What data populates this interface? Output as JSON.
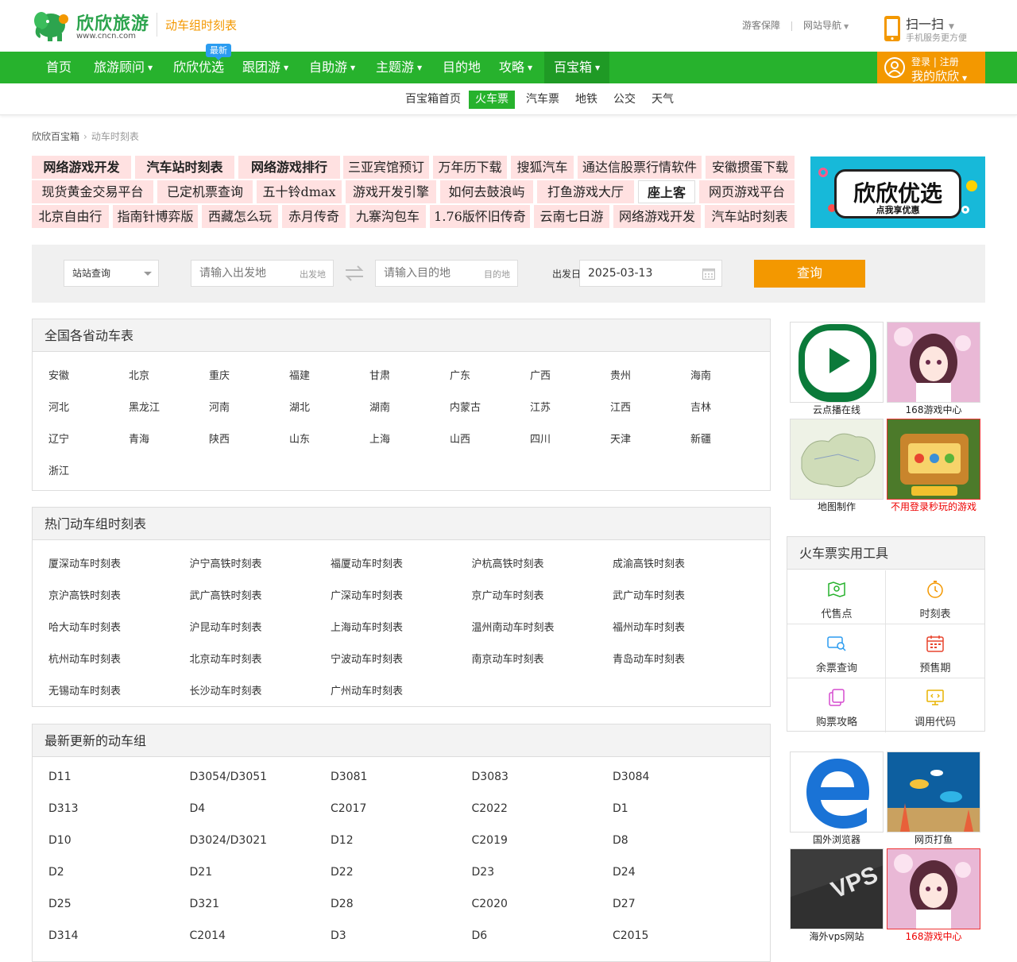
{
  "header": {
    "logo_name": "欣欣旅游",
    "logo_url": "www.cncn.com",
    "page_subtitle": "动车组时刻表",
    "top_links": [
      "游客保障",
      "网站导航"
    ],
    "scan_title": "扫一扫",
    "scan_sub": "手机服务更方便"
  },
  "nav": {
    "items": [
      "首页",
      "旅游顾问",
      "欣欣优选",
      "跟团游",
      "自助游",
      "主题游",
      "目的地",
      "攻略",
      "百宝箱"
    ],
    "new_badge": "最新",
    "login": "登录",
    "register": "注册",
    "my": "我的欣欣"
  },
  "subnav": {
    "items": [
      "百宝箱首页",
      "火车票",
      "汽车票",
      "地铁",
      "公交",
      "天气"
    ],
    "active": "火车票"
  },
  "breadcrumb": {
    "home": "欣欣百宝箱",
    "current": "动车时刻表"
  },
  "ad_tags": [
    "网络游戏开发",
    "汽车站时刻表",
    "网络游戏排行",
    "三亚宾馆预订",
    "万年历下载",
    "搜狐汽车",
    "通达信股票行情软件",
    "安徽掼蛋下载",
    "现货黄金交易平台",
    "已定机票查询",
    "五十铃dmax",
    "游戏开发引擎",
    "如何去鼓浪屿",
    "打鱼游戏大厅",
    "座上客",
    "网页游戏平台",
    "北京自由行",
    "指南针博弈版",
    "西藏怎么玩",
    "赤月传奇",
    "九寨沟包车",
    "1.76版怀旧传奇",
    "云南七日游",
    "网络游戏开发",
    "汽车站时刻表"
  ],
  "banner": {
    "title": "欣欣优选",
    "sub": "点我享优惠"
  },
  "search": {
    "mode": "站站查询",
    "from_placeholder": "请输入出发地",
    "from_hint": "出发地",
    "to_placeholder": "请输入目的地",
    "to_hint": "目的地",
    "date_label": "出发日期",
    "date": "2025-03-13",
    "button": "查询"
  },
  "provinces": {
    "title": "全国各省动车表",
    "items": [
      "安徽",
      "北京",
      "重庆",
      "福建",
      "甘肃",
      "广东",
      "广西",
      "贵州",
      "海南",
      "河北",
      "黑龙江",
      "河南",
      "湖北",
      "湖南",
      "内蒙古",
      "江苏",
      "江西",
      "吉林",
      "辽宁",
      "青海",
      "陕西",
      "山东",
      "上海",
      "山西",
      "四川",
      "天津",
      "新疆",
      "浙江"
    ]
  },
  "hot": {
    "title": "热门动车组时刻表",
    "items": [
      "厦深动车时刻表",
      "沪宁高铁时刻表",
      "福厦动车时刻表",
      "沪杭高铁时刻表",
      "成渝高铁时刻表",
      "京沪高铁时刻表",
      "武广高铁时刻表",
      "广深动车时刻表",
      "京广动车时刻表",
      "武广动车时刻表",
      "哈大动车时刻表",
      "沪昆动车时刻表",
      "上海动车时刻表",
      "温州南动车时刻表",
      "福州动车时刻表",
      "杭州动车时刻表",
      "北京动车时刻表",
      "宁波动车时刻表",
      "南京动车时刻表",
      "青岛动车时刻表",
      "无锡动车时刻表",
      "长沙动车时刻表",
      "广州动车时刻表"
    ]
  },
  "latest": {
    "title": "最新更新的动车组",
    "items": [
      "D11",
      "D3054/D3051",
      "D3081",
      "D3083",
      "D3084",
      "D313",
      "D4",
      "C2017",
      "C2022",
      "D1",
      "D10",
      "D3024/D3021",
      "D12",
      "C2019",
      "D8",
      "D2",
      "D21",
      "D22",
      "D23",
      "D24",
      "D25",
      "D321",
      "D28",
      "C2020",
      "D27",
      "D314",
      "C2014",
      "D3",
      "D6",
      "C2015"
    ]
  },
  "side_ads_top": [
    "云点播在线",
    "168游戏中心",
    "地图制作",
    "不用登录秒玩的游戏"
  ],
  "tools": {
    "title": "火车票实用工具",
    "items": [
      "代售点",
      "时刻表",
      "余票查询",
      "预售期",
      "购票攻略",
      "调用代码"
    ]
  },
  "side_ads_bottom": [
    "国外浏览器",
    "网页打鱼",
    "海外vps网站",
    "168游戏中心"
  ],
  "colors": {
    "brand_green": "#27b22d",
    "accent_orange": "#f39800",
    "tag_pink": "#ffe1e1",
    "ad_red": "#ee0000"
  }
}
